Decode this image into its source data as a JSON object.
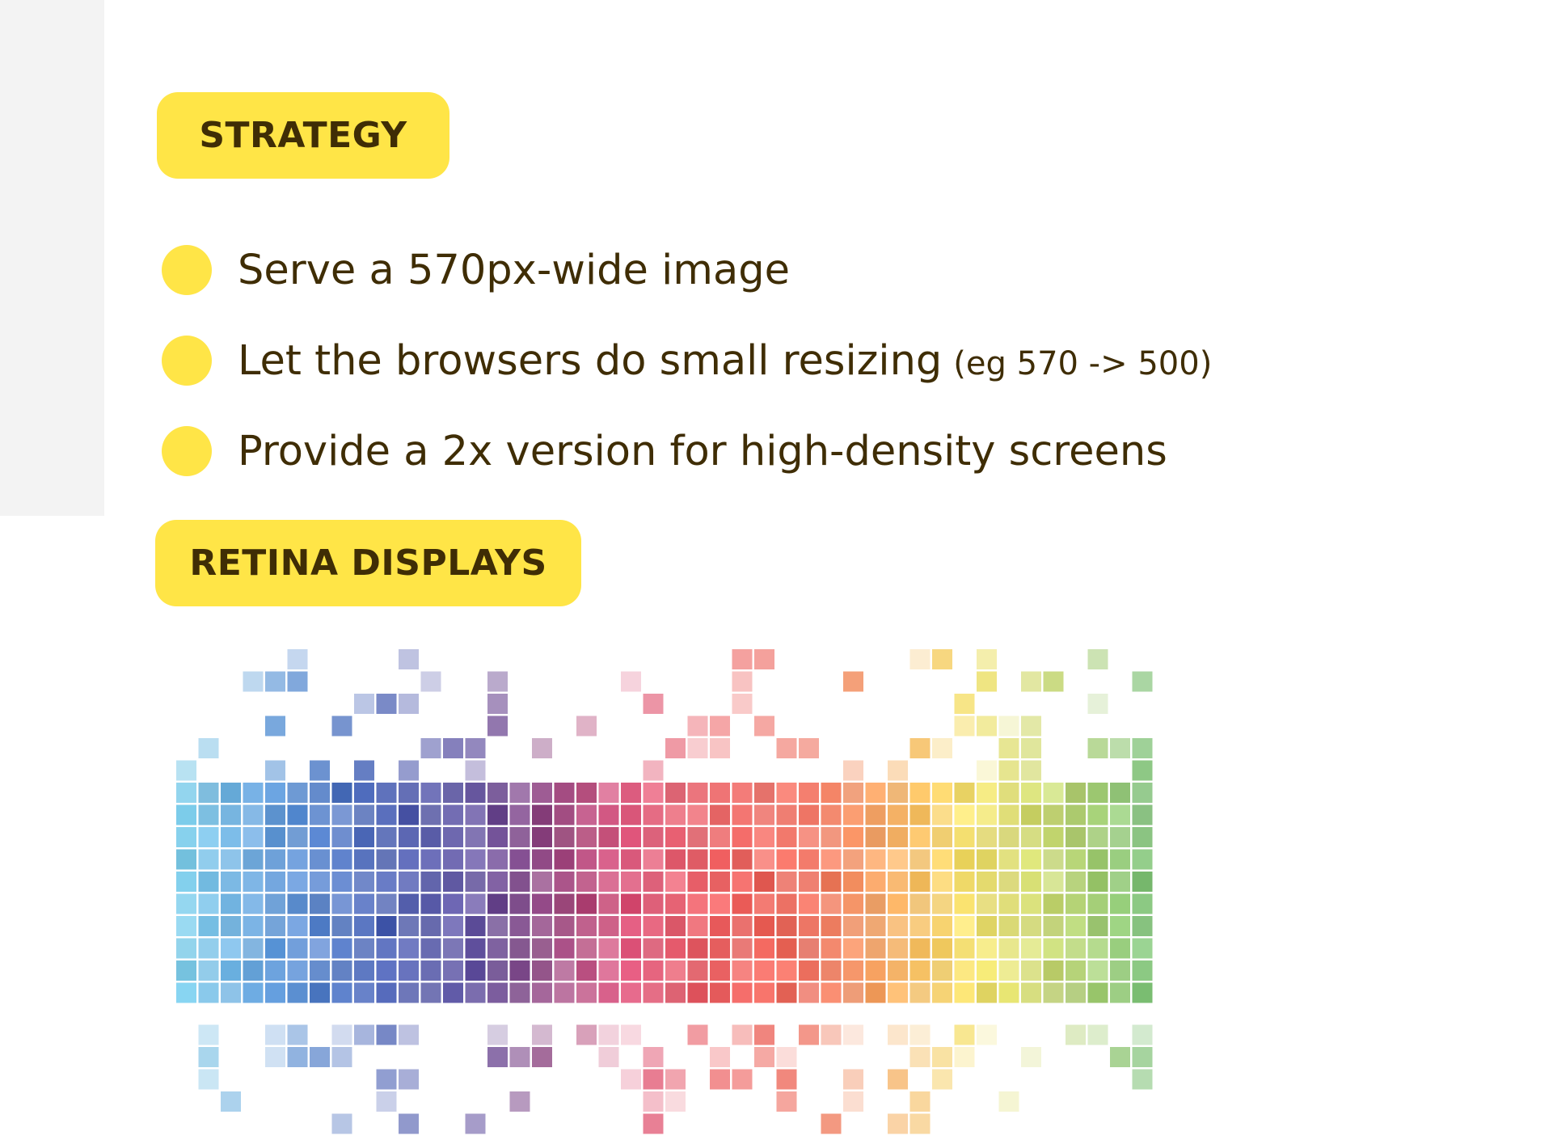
{
  "sections": {
    "strategy": {
      "label": "STRATEGY",
      "items": [
        {
          "text": "Serve a 570px-wide image",
          "note": ""
        },
        {
          "text": "Let the browsers do small resizing",
          "note": "(eg 570 -> 500)"
        },
        {
          "text": "Provide a 2x version for high-density screens",
          "note": ""
        }
      ]
    },
    "retina": {
      "label": "RETINA DISPLAYS"
    }
  },
  "colors": {
    "accent": "#ffe547",
    "text": "#3f2d05",
    "sidebar": "#f3f3f3"
  },
  "illustration": {
    "icon": "pixel-spectrum-mosaic"
  }
}
